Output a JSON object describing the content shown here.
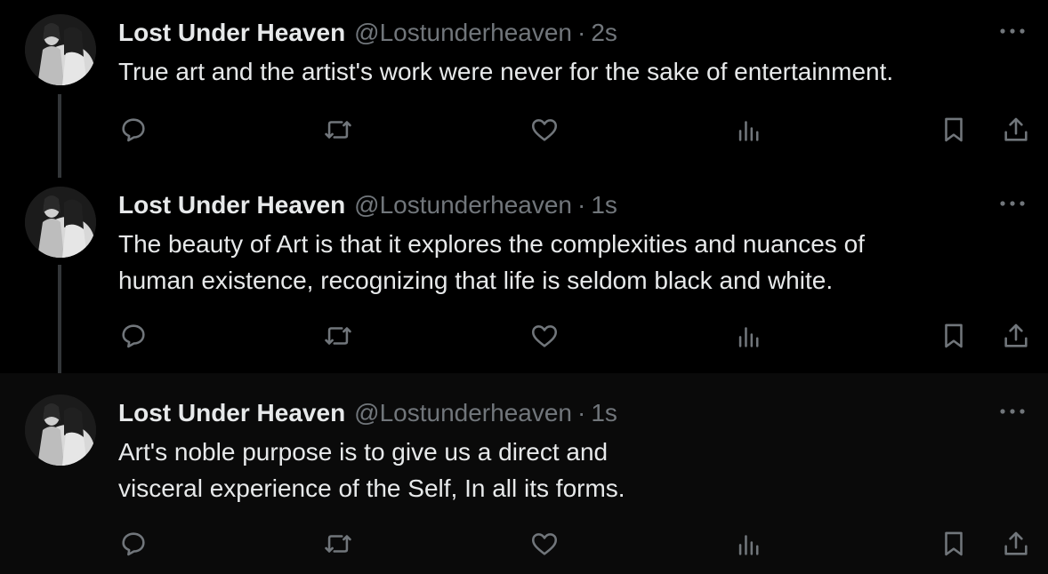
{
  "thread": {
    "tweets": [
      {
        "display_name": "Lost Under Heaven",
        "handle": "@Lostunderheaven",
        "separator": "·",
        "time": "2s",
        "lines": [
          "True art and the artist's work were never for the sake of entertainment."
        ]
      },
      {
        "display_name": "Lost Under Heaven",
        "handle": "@Lostunderheaven",
        "separator": "·",
        "time": "1s",
        "lines": [
          "The beauty of Art is that it explores the complexities and nuances of",
          "human existence, recognizing that life is seldom black and white."
        ]
      },
      {
        "display_name": "Lost Under Heaven",
        "handle": "@Lostunderheaven",
        "separator": "·",
        "time": "1s",
        "lines": [
          "Art's noble purpose is to give us a direct and",
          "visceral experience of the Self, In all its forms."
        ]
      }
    ],
    "icons": {
      "avatar": "avatar-photo",
      "more": "more-options-icon",
      "reply": "reply-icon",
      "retweet": "retweet-icon",
      "like": "like-icon",
      "views": "views-icon",
      "bookmark": "bookmark-icon",
      "share": "share-icon"
    }
  },
  "colors": {
    "background": "#000000",
    "highlighted_background": "#0a0a0a",
    "primary_text": "#e7e9ea",
    "secondary_text": "#71767b",
    "thread_line": "#333639"
  }
}
